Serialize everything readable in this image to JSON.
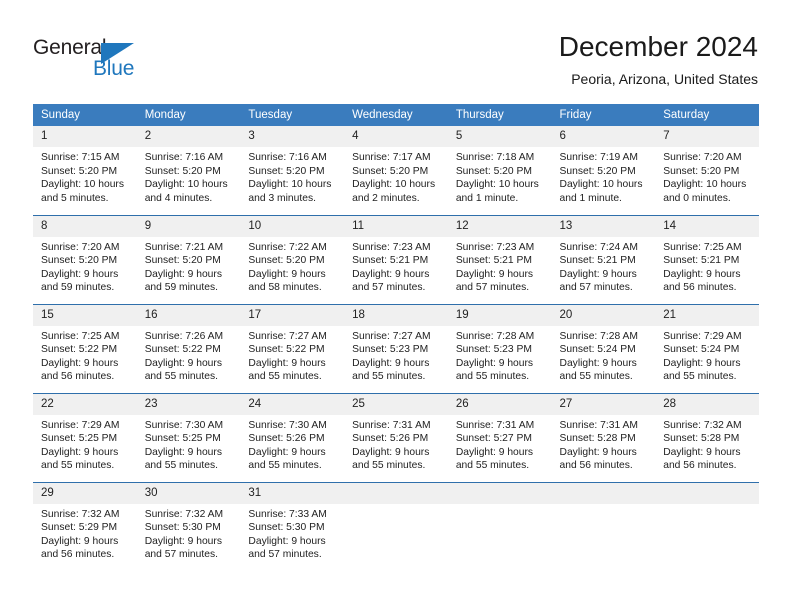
{
  "brand": {
    "name_part1": "General",
    "name_part2": "Blue",
    "triangle_color": "#1f77bd"
  },
  "header": {
    "title": "December 2024",
    "subtitle": "Peoria, Arizona, United States"
  },
  "colors": {
    "header_band": "#3a7cbe",
    "row_divider": "#2f6fab",
    "daynum_background": "#f0f0f0",
    "text": "#222222"
  },
  "weekdays": [
    "Sunday",
    "Monday",
    "Tuesday",
    "Wednesday",
    "Thursday",
    "Friday",
    "Saturday"
  ],
  "weeks": [
    [
      {
        "day": "1",
        "sunrise": "Sunrise: 7:15 AM",
        "sunset": "Sunset: 5:20 PM",
        "daylight_line1": "Daylight: 10 hours",
        "daylight_line2": "and 5 minutes."
      },
      {
        "day": "2",
        "sunrise": "Sunrise: 7:16 AM",
        "sunset": "Sunset: 5:20 PM",
        "daylight_line1": "Daylight: 10 hours",
        "daylight_line2": "and 4 minutes."
      },
      {
        "day": "3",
        "sunrise": "Sunrise: 7:16 AM",
        "sunset": "Sunset: 5:20 PM",
        "daylight_line1": "Daylight: 10 hours",
        "daylight_line2": "and 3 minutes."
      },
      {
        "day": "4",
        "sunrise": "Sunrise: 7:17 AM",
        "sunset": "Sunset: 5:20 PM",
        "daylight_line1": "Daylight: 10 hours",
        "daylight_line2": "and 2 minutes."
      },
      {
        "day": "5",
        "sunrise": "Sunrise: 7:18 AM",
        "sunset": "Sunset: 5:20 PM",
        "daylight_line1": "Daylight: 10 hours",
        "daylight_line2": "and 1 minute."
      },
      {
        "day": "6",
        "sunrise": "Sunrise: 7:19 AM",
        "sunset": "Sunset: 5:20 PM",
        "daylight_line1": "Daylight: 10 hours",
        "daylight_line2": "and 1 minute."
      },
      {
        "day": "7",
        "sunrise": "Sunrise: 7:20 AM",
        "sunset": "Sunset: 5:20 PM",
        "daylight_line1": "Daylight: 10 hours",
        "daylight_line2": "and 0 minutes."
      }
    ],
    [
      {
        "day": "8",
        "sunrise": "Sunrise: 7:20 AM",
        "sunset": "Sunset: 5:20 PM",
        "daylight_line1": "Daylight: 9 hours",
        "daylight_line2": "and 59 minutes."
      },
      {
        "day": "9",
        "sunrise": "Sunrise: 7:21 AM",
        "sunset": "Sunset: 5:20 PM",
        "daylight_line1": "Daylight: 9 hours",
        "daylight_line2": "and 59 minutes."
      },
      {
        "day": "10",
        "sunrise": "Sunrise: 7:22 AM",
        "sunset": "Sunset: 5:20 PM",
        "daylight_line1": "Daylight: 9 hours",
        "daylight_line2": "and 58 minutes."
      },
      {
        "day": "11",
        "sunrise": "Sunrise: 7:23 AM",
        "sunset": "Sunset: 5:21 PM",
        "daylight_line1": "Daylight: 9 hours",
        "daylight_line2": "and 57 minutes."
      },
      {
        "day": "12",
        "sunrise": "Sunrise: 7:23 AM",
        "sunset": "Sunset: 5:21 PM",
        "daylight_line1": "Daylight: 9 hours",
        "daylight_line2": "and 57 minutes."
      },
      {
        "day": "13",
        "sunrise": "Sunrise: 7:24 AM",
        "sunset": "Sunset: 5:21 PM",
        "daylight_line1": "Daylight: 9 hours",
        "daylight_line2": "and 57 minutes."
      },
      {
        "day": "14",
        "sunrise": "Sunrise: 7:25 AM",
        "sunset": "Sunset: 5:21 PM",
        "daylight_line1": "Daylight: 9 hours",
        "daylight_line2": "and 56 minutes."
      }
    ],
    [
      {
        "day": "15",
        "sunrise": "Sunrise: 7:25 AM",
        "sunset": "Sunset: 5:22 PM",
        "daylight_line1": "Daylight: 9 hours",
        "daylight_line2": "and 56 minutes."
      },
      {
        "day": "16",
        "sunrise": "Sunrise: 7:26 AM",
        "sunset": "Sunset: 5:22 PM",
        "daylight_line1": "Daylight: 9 hours",
        "daylight_line2": "and 55 minutes."
      },
      {
        "day": "17",
        "sunrise": "Sunrise: 7:27 AM",
        "sunset": "Sunset: 5:22 PM",
        "daylight_line1": "Daylight: 9 hours",
        "daylight_line2": "and 55 minutes."
      },
      {
        "day": "18",
        "sunrise": "Sunrise: 7:27 AM",
        "sunset": "Sunset: 5:23 PM",
        "daylight_line1": "Daylight: 9 hours",
        "daylight_line2": "and 55 minutes."
      },
      {
        "day": "19",
        "sunrise": "Sunrise: 7:28 AM",
        "sunset": "Sunset: 5:23 PM",
        "daylight_line1": "Daylight: 9 hours",
        "daylight_line2": "and 55 minutes."
      },
      {
        "day": "20",
        "sunrise": "Sunrise: 7:28 AM",
        "sunset": "Sunset: 5:24 PM",
        "daylight_line1": "Daylight: 9 hours",
        "daylight_line2": "and 55 minutes."
      },
      {
        "day": "21",
        "sunrise": "Sunrise: 7:29 AM",
        "sunset": "Sunset: 5:24 PM",
        "daylight_line1": "Daylight: 9 hours",
        "daylight_line2": "and 55 minutes."
      }
    ],
    [
      {
        "day": "22",
        "sunrise": "Sunrise: 7:29 AM",
        "sunset": "Sunset: 5:25 PM",
        "daylight_line1": "Daylight: 9 hours",
        "daylight_line2": "and 55 minutes."
      },
      {
        "day": "23",
        "sunrise": "Sunrise: 7:30 AM",
        "sunset": "Sunset: 5:25 PM",
        "daylight_line1": "Daylight: 9 hours",
        "daylight_line2": "and 55 minutes."
      },
      {
        "day": "24",
        "sunrise": "Sunrise: 7:30 AM",
        "sunset": "Sunset: 5:26 PM",
        "daylight_line1": "Daylight: 9 hours",
        "daylight_line2": "and 55 minutes."
      },
      {
        "day": "25",
        "sunrise": "Sunrise: 7:31 AM",
        "sunset": "Sunset: 5:26 PM",
        "daylight_line1": "Daylight: 9 hours",
        "daylight_line2": "and 55 minutes."
      },
      {
        "day": "26",
        "sunrise": "Sunrise: 7:31 AM",
        "sunset": "Sunset: 5:27 PM",
        "daylight_line1": "Daylight: 9 hours",
        "daylight_line2": "and 55 minutes."
      },
      {
        "day": "27",
        "sunrise": "Sunrise: 7:31 AM",
        "sunset": "Sunset: 5:28 PM",
        "daylight_line1": "Daylight: 9 hours",
        "daylight_line2": "and 56 minutes."
      },
      {
        "day": "28",
        "sunrise": "Sunrise: 7:32 AM",
        "sunset": "Sunset: 5:28 PM",
        "daylight_line1": "Daylight: 9 hours",
        "daylight_line2": "and 56 minutes."
      }
    ],
    [
      {
        "day": "29",
        "sunrise": "Sunrise: 7:32 AM",
        "sunset": "Sunset: 5:29 PM",
        "daylight_line1": "Daylight: 9 hours",
        "daylight_line2": "and 56 minutes."
      },
      {
        "day": "30",
        "sunrise": "Sunrise: 7:32 AM",
        "sunset": "Sunset: 5:30 PM",
        "daylight_line1": "Daylight: 9 hours",
        "daylight_line2": "and 57 minutes."
      },
      {
        "day": "31",
        "sunrise": "Sunrise: 7:33 AM",
        "sunset": "Sunset: 5:30 PM",
        "daylight_line1": "Daylight: 9 hours",
        "daylight_line2": "and 57 minutes."
      },
      {
        "day": "",
        "sunrise": "",
        "sunset": "",
        "daylight_line1": "",
        "daylight_line2": ""
      },
      {
        "day": "",
        "sunrise": "",
        "sunset": "",
        "daylight_line1": "",
        "daylight_line2": ""
      },
      {
        "day": "",
        "sunrise": "",
        "sunset": "",
        "daylight_line1": "",
        "daylight_line2": ""
      },
      {
        "day": "",
        "sunrise": "",
        "sunset": "",
        "daylight_line1": "",
        "daylight_line2": ""
      }
    ]
  ]
}
